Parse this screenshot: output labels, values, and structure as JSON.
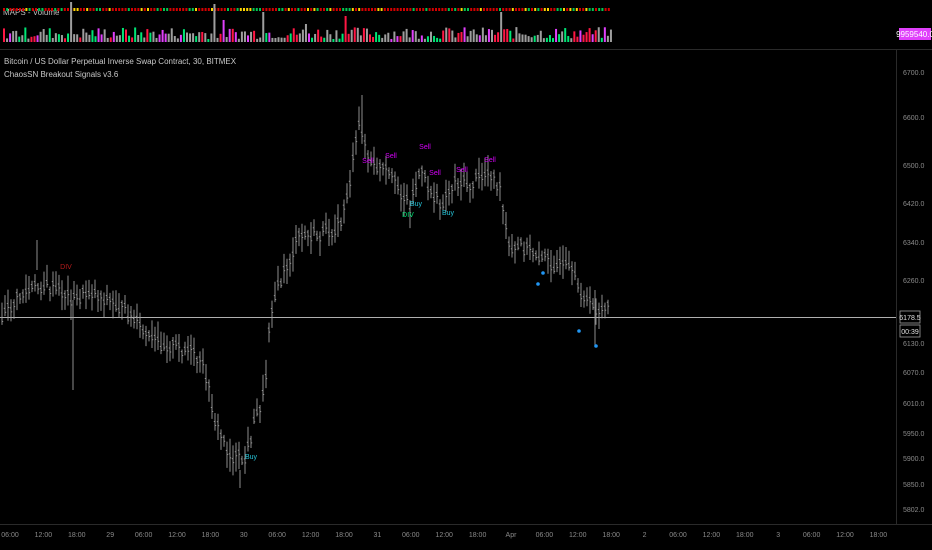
{
  "volume_panel": {
    "title": "MAPS - Volume",
    "value_badge": "9959540.0"
  },
  "header": {
    "symbol_line": "Bitcoin / US Dollar Perpetual Inverse Swap Contract, 30, BITMEX",
    "indicator_line": "ChaosSN Breakout Signals v3.6"
  },
  "price_axis": {
    "ticks": [
      "6700.0",
      "6600.0",
      "6500.0",
      "6420.0",
      "6340.0",
      "6260.0",
      "6130.0",
      "6070.0",
      "6010.0",
      "5950.0",
      "5900.0",
      "5850.0",
      "5802.0"
    ],
    "last_price": "6178.5",
    "countdown": "00:39"
  },
  "time_axis": {
    "ticks": [
      "06:00",
      "12:00",
      "18:00",
      "29",
      "06:00",
      "12:00",
      "18:00",
      "30",
      "06:00",
      "12:00",
      "18:00",
      "31",
      "06:00",
      "12:00",
      "18:00",
      "Apr",
      "06:00",
      "12:00",
      "18:00",
      "2",
      "06:00",
      "12:00",
      "18:00",
      "3",
      "06:00",
      "12:00",
      "18:00"
    ]
  },
  "signals": [
    {
      "text": "DIV",
      "color": "#b71c1c"
    },
    {
      "text": "Buy",
      "color": "#26c6da"
    },
    {
      "text": "Sell",
      "color": "#d500f9"
    },
    {
      "text": "Sell",
      "color": "#d500f9"
    },
    {
      "text": "Buy",
      "color": "#26c6da"
    },
    {
      "text": "DIV",
      "color": "#00e676"
    },
    {
      "text": "Sell",
      "color": "#d500f9"
    },
    {
      "text": "Sell",
      "color": "#d500f9"
    },
    {
      "text": "Sell",
      "color": "#d500f9"
    },
    {
      "text": "Buy",
      "color": "#26c6da"
    },
    {
      "text": "Sell",
      "color": "#d500f9"
    }
  ],
  "colors": {
    "background": "#000000",
    "bar": "#9e9e9e",
    "volume_up": "#00e676",
    "volume_down": "#ff1744",
    "volume_neutral": "#9e9e9e",
    "volume_magenta": "#e040fb",
    "price_line": "#b0b0b0",
    "dot": "#2196f3",
    "badge": "#e040fb"
  }
}
